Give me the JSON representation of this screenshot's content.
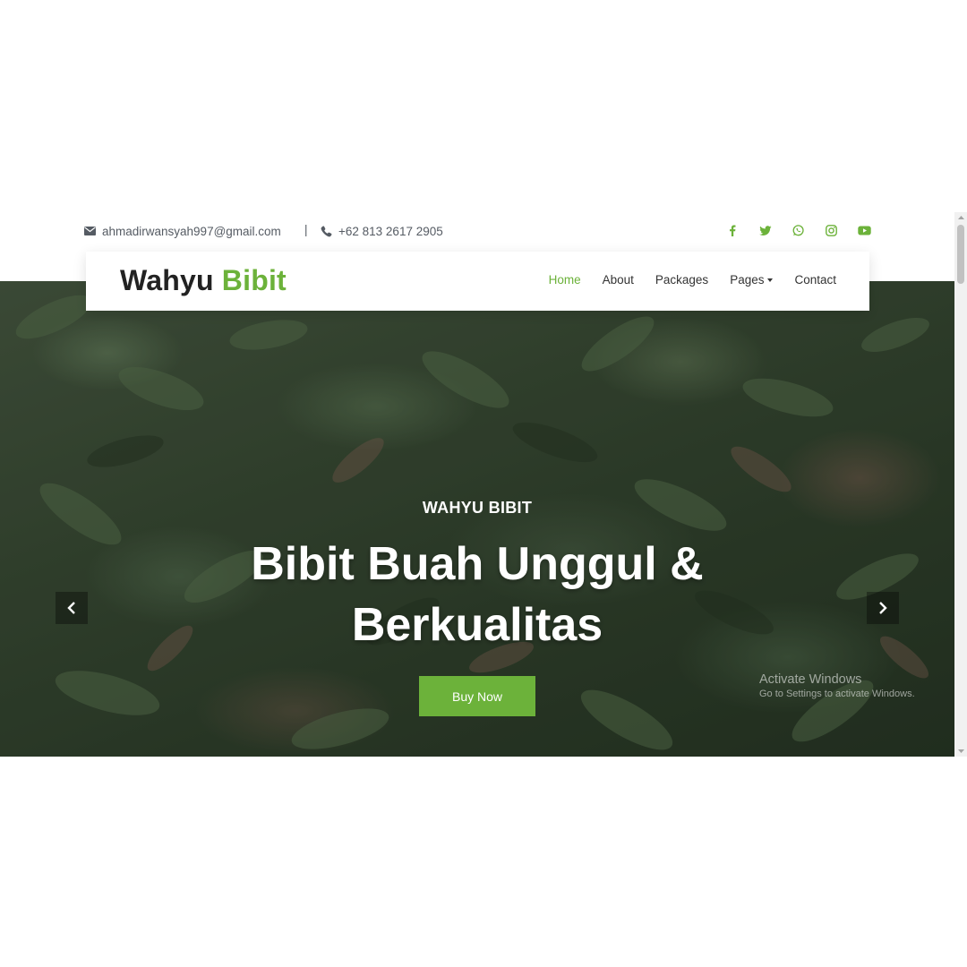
{
  "topbar": {
    "email": "ahmadirwansyah997@gmail.com",
    "separator": "|",
    "phone": "+62 813 2617 2905",
    "social_icons": [
      "facebook-icon",
      "twitter-icon",
      "whatsapp-icon",
      "instagram-icon",
      "youtube-icon"
    ]
  },
  "brand": {
    "part1": "Wahyu",
    "part2": "Bibit"
  },
  "nav": {
    "items": [
      "Home",
      "About",
      "Packages",
      "Pages",
      "Contact"
    ],
    "active": "Home"
  },
  "hero": {
    "subtitle": "WAHYU BIBIT",
    "title_line1": "Bibit Buah Unggul &",
    "title_line2": "Berkualitas",
    "button": "Buy Now"
  },
  "watermark": {
    "line1": "Activate Windows",
    "line2": "Go to Settings to activate Windows."
  },
  "colors": {
    "accent": "#6cb23a",
    "text": "#222222",
    "muted": "#555b63"
  }
}
